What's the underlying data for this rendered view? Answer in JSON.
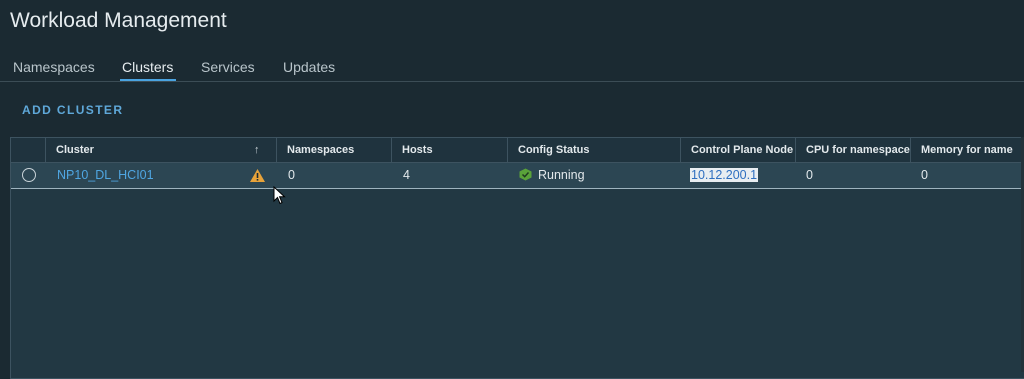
{
  "header": {
    "title": "Workload Management"
  },
  "tabs": [
    {
      "label": "Namespaces",
      "active": false
    },
    {
      "label": "Clusters",
      "active": true
    },
    {
      "label": "Services",
      "active": false
    },
    {
      "label": "Updates",
      "active": false
    }
  ],
  "actions": {
    "add_cluster_label": "ADD CLUSTER"
  },
  "table": {
    "columns": [
      "Cluster",
      "Namespaces",
      "Hosts",
      "Config Status",
      "Control Plane Node",
      "CPU for namespaces",
      "Memory for name"
    ],
    "sort": {
      "column": "Cluster",
      "direction": "ascending",
      "icon": "arrow-up-icon"
    },
    "rows": [
      {
        "selected": false,
        "cluster": "NP10_DL_HCI01",
        "warning_icon": "warning-triangle-icon",
        "namespaces": "0",
        "hosts": "4",
        "config_status": "Running",
        "status_icon": "green-check-shield-icon",
        "control_plane_node": "10.12.200.1",
        "cpu_for_namespaces": "0",
        "memory_for_namespaces": "0"
      }
    ]
  },
  "colors": {
    "background": "#1b2a32",
    "accent": "#4aa3e0",
    "link": "#4fa6e2",
    "warning": "#e8a33a",
    "status_ok": "#5aa33a"
  }
}
